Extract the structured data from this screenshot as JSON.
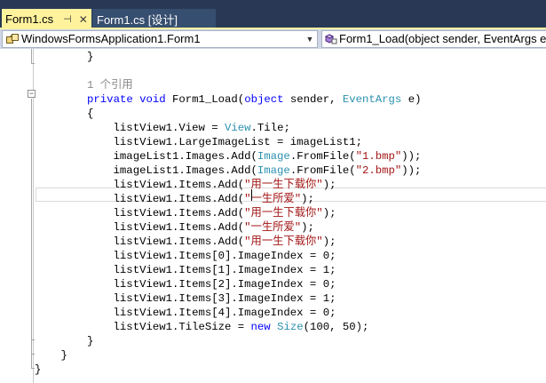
{
  "tabs": [
    {
      "title": "Form1.cs",
      "pin_glyph": "⊣",
      "close_glyph": "✕",
      "active": true
    },
    {
      "title": "Form1.cs [设计]",
      "active": false
    }
  ],
  "navbar": {
    "class_combo": "WindowsFormsApplication1.Form1",
    "member_combo": "Form1_Load(object sender, EventArgs e)",
    "dropdown_glyph": "▼"
  },
  "editor": {
    "fold_glyph": "−",
    "lines": [
      [
        {
          "t": "        }"
        }
      ],
      [
        {
          "t": ""
        }
      ],
      [
        {
          "t": "        "
        },
        {
          "t": "1 个引用",
          "c": "ref"
        }
      ],
      [
        {
          "t": "        "
        },
        {
          "t": "private",
          "c": "kw"
        },
        {
          "t": " "
        },
        {
          "t": "void",
          "c": "kw"
        },
        {
          "t": " Form1_Load("
        },
        {
          "t": "object",
          "c": "kw"
        },
        {
          "t": " sender, "
        },
        {
          "t": "EventArgs",
          "c": "ty"
        },
        {
          "t": " e)"
        }
      ],
      [
        {
          "t": "        {"
        }
      ],
      [
        {
          "t": "            listView1.View = "
        },
        {
          "t": "View",
          "c": "ty"
        },
        {
          "t": ".Tile;"
        }
      ],
      [
        {
          "t": "            listView1.LargeImageList = imageList1;"
        }
      ],
      [
        {
          "t": "            imageList1.Images.Add("
        },
        {
          "t": "Image",
          "c": "ty"
        },
        {
          "t": ".FromFile("
        },
        {
          "t": "\"1.bmp\"",
          "c": "str"
        },
        {
          "t": "));"
        }
      ],
      [
        {
          "t": "            imageList1.Images.Add("
        },
        {
          "t": "Image",
          "c": "ty"
        },
        {
          "t": ".FromFile("
        },
        {
          "t": "\"2.bmp\"",
          "c": "str"
        },
        {
          "t": "));"
        }
      ],
      [
        {
          "t": "            listView1.Items.Add("
        },
        {
          "t": "\"用一生下载你\"",
          "c": "str"
        },
        {
          "t": ");"
        }
      ],
      [
        {
          "t": "            listView1.Items.Add("
        },
        {
          "t": "\"一生所爱\"",
          "c": "str"
        },
        {
          "t": ");"
        }
      ],
      [
        {
          "t": "            listView1.Items.Add("
        },
        {
          "t": "\"用一生下载你\"",
          "c": "str"
        },
        {
          "t": ");"
        }
      ],
      [
        {
          "t": "            listView1.Items.Add("
        },
        {
          "t": "\"一生所爱\"",
          "c": "str"
        },
        {
          "t": ");"
        }
      ],
      [
        {
          "t": "            listView1.Items.Add("
        },
        {
          "t": "\"用一生下载你\"",
          "c": "str"
        },
        {
          "t": ");"
        }
      ],
      [
        {
          "t": "            listView1.Items[0].ImageIndex = 0;"
        }
      ],
      [
        {
          "t": "            listView1.Items[1].ImageIndex = 1;"
        }
      ],
      [
        {
          "t": "            listView1.Items[2].ImageIndex = 0;"
        }
      ],
      [
        {
          "t": "            listView1.Items[3].ImageIndex = 1;"
        }
      ],
      [
        {
          "t": "            listView1.Items[4].ImageIndex = 0;"
        }
      ],
      [
        {
          "t": "            listView1.TileSize = "
        },
        {
          "t": "new",
          "c": "kw"
        },
        {
          "t": " "
        },
        {
          "t": "Size",
          "c": "ty"
        },
        {
          "t": "(100, 50);"
        }
      ],
      [
        {
          "t": "        }"
        }
      ],
      [
        {
          "t": "    }"
        }
      ],
      [
        {
          "t": "}"
        }
      ]
    ]
  }
}
